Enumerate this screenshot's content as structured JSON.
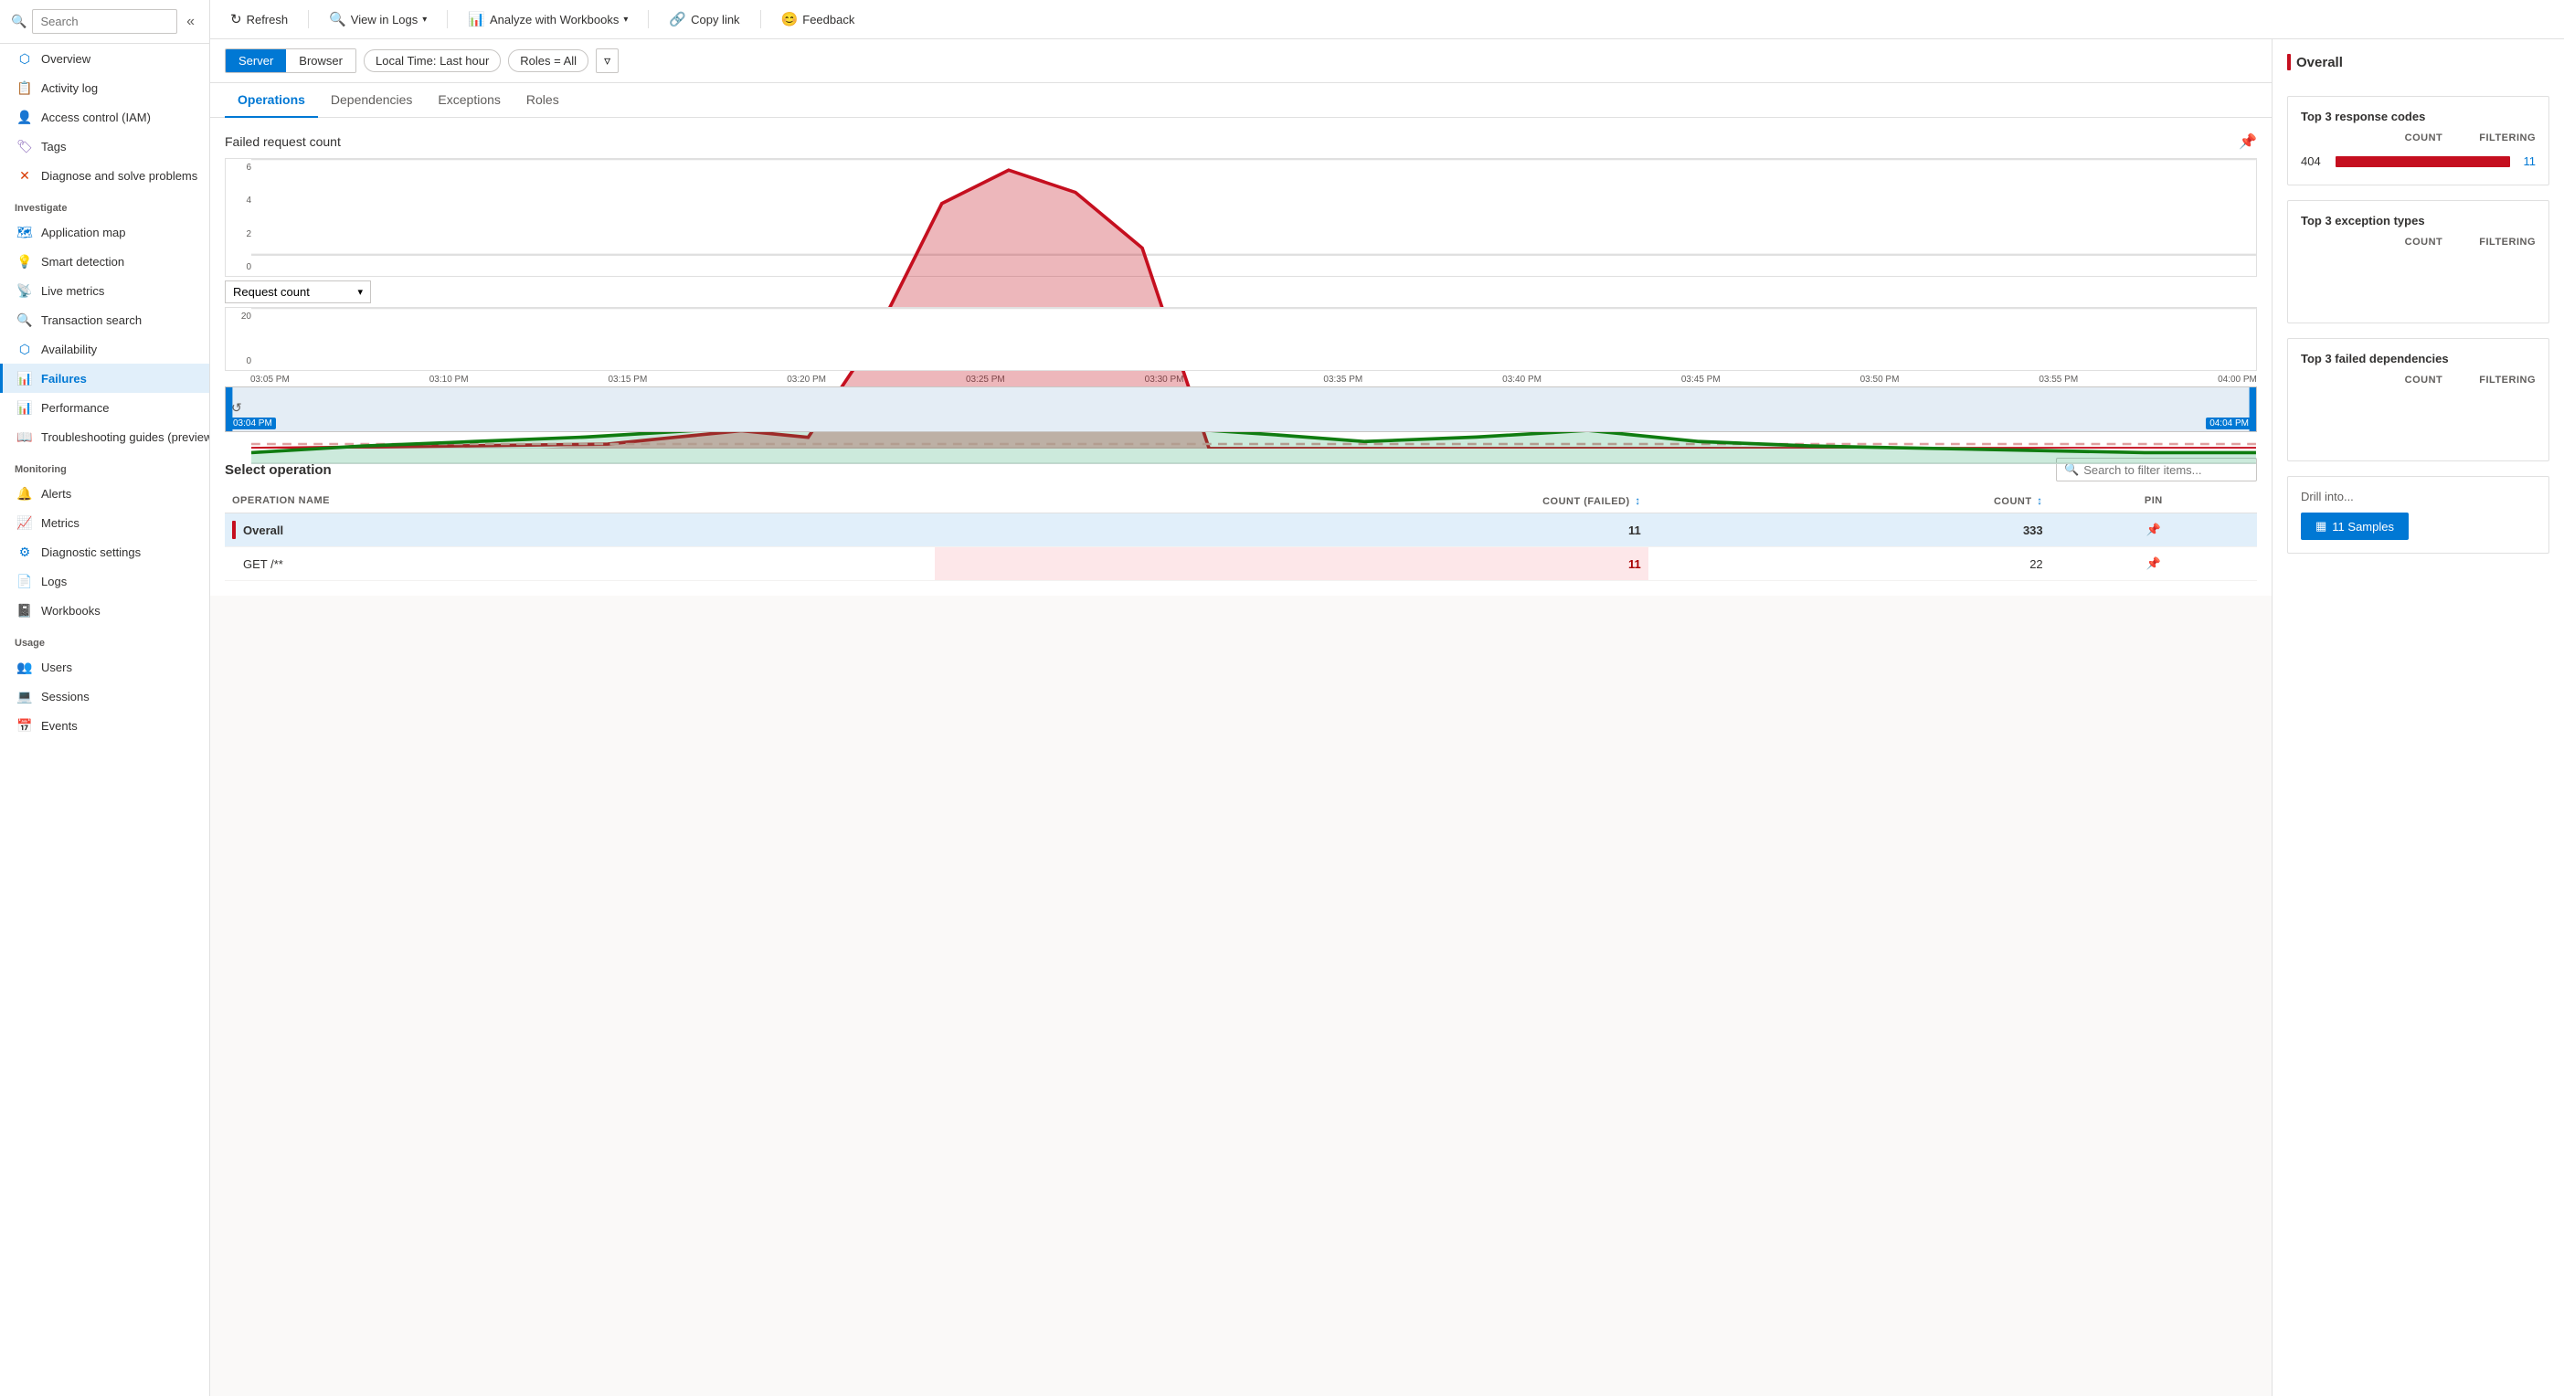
{
  "sidebar": {
    "search_placeholder": "Search",
    "collapse_label": "Collapse",
    "items": [
      {
        "id": "overview",
        "label": "Overview",
        "icon": "⬡",
        "icon_class": "icon-overview"
      },
      {
        "id": "activity-log",
        "label": "Activity log",
        "icon": "📋",
        "icon_class": "icon-activity"
      },
      {
        "id": "access-control",
        "label": "Access control (IAM)",
        "icon": "👤",
        "icon_class": "icon-iam"
      },
      {
        "id": "tags",
        "label": "Tags",
        "icon": "🏷",
        "icon_class": "icon-tags"
      },
      {
        "id": "diagnose",
        "label": "Diagnose and solve problems",
        "icon": "✕",
        "icon_class": "icon-diagnose"
      }
    ],
    "investigate_label": "Investigate",
    "investigate_items": [
      {
        "id": "app-map",
        "label": "Application map",
        "icon": "🗺",
        "icon_class": "icon-appmap"
      },
      {
        "id": "smart-detect",
        "label": "Smart detection",
        "icon": "💡",
        "icon_class": "icon-smart"
      },
      {
        "id": "live-metrics",
        "label": "Live metrics",
        "icon": "🔍",
        "icon_class": "icon-live"
      },
      {
        "id": "tx-search",
        "label": "Transaction search",
        "icon": "🔍",
        "icon_class": "icon-txsearch"
      },
      {
        "id": "availability",
        "label": "Availability",
        "icon": "⬡",
        "icon_class": "icon-availability"
      },
      {
        "id": "failures",
        "label": "Failures",
        "icon": "📊",
        "icon_class": "icon-failures",
        "active": true
      },
      {
        "id": "performance",
        "label": "Performance",
        "icon": "📊",
        "icon_class": "icon-perf"
      },
      {
        "id": "troubleshoot",
        "label": "Troubleshooting guides (preview)",
        "icon": "📖",
        "icon_class": "icon-troubleshoot"
      }
    ],
    "monitoring_label": "Monitoring",
    "monitoring_items": [
      {
        "id": "alerts",
        "label": "Alerts",
        "icon": "🔔",
        "icon_class": "icon-alerts"
      },
      {
        "id": "metrics",
        "label": "Metrics",
        "icon": "📈",
        "icon_class": "icon-metrics"
      },
      {
        "id": "diagnostic-settings",
        "label": "Diagnostic settings",
        "icon": "⚙",
        "icon_class": "icon-diag"
      },
      {
        "id": "logs",
        "label": "Logs",
        "icon": "📄",
        "icon_class": "icon-logs"
      },
      {
        "id": "workbooks",
        "label": "Workbooks",
        "icon": "📓",
        "icon_class": "icon-workbooks"
      }
    ],
    "usage_label": "Usage",
    "usage_items": [
      {
        "id": "users",
        "label": "Users",
        "icon": "👥",
        "icon_class": "icon-users"
      },
      {
        "id": "sessions",
        "label": "Sessions",
        "icon": "💻",
        "icon_class": "icon-sessions"
      },
      {
        "id": "events",
        "label": "Events",
        "icon": "📅",
        "icon_class": "icon-events"
      }
    ]
  },
  "toolbar": {
    "refresh_label": "Refresh",
    "view_logs_label": "View in Logs",
    "analyze_label": "Analyze with Workbooks",
    "copy_link_label": "Copy link",
    "feedback_label": "Feedback"
  },
  "filter_bar": {
    "server_label": "Server",
    "browser_label": "Browser",
    "time_label": "Local Time: Last hour",
    "roles_label": "Roles = All"
  },
  "tabs": [
    {
      "id": "operations",
      "label": "Operations",
      "active": true
    },
    {
      "id": "dependencies",
      "label": "Dependencies"
    },
    {
      "id": "exceptions",
      "label": "Exceptions"
    },
    {
      "id": "roles",
      "label": "Roles"
    }
  ],
  "chart": {
    "title": "Failed request count",
    "y_labels": [
      "6",
      "4",
      "2",
      "0"
    ],
    "time_labels": [
      "03:05 PM",
      "03:10 PM",
      "03:15 PM",
      "03:20 PM",
      "03:25 PM",
      "03:30 PM",
      "03:35 PM",
      "03:40 PM",
      "03:45 PM",
      "03:50 PM",
      "03:55 PM",
      "04:00 PM"
    ],
    "dropdown_label": "Request count",
    "bottom_y_labels": [
      "20",
      "0"
    ],
    "brush_start": "03:04 PM",
    "brush_end": "04:04 PM"
  },
  "operations_table": {
    "title": "Select operation",
    "search_placeholder": "Search to filter items...",
    "columns": {
      "name": "OPERATION NAME",
      "count_failed": "COUNT (FAILED)",
      "count": "COUNT",
      "pin": "PIN"
    },
    "rows": [
      {
        "id": "overall",
        "name": "Overall",
        "count_failed": "11",
        "count": "333",
        "selected": true,
        "color": "#c50f1f"
      },
      {
        "id": "get-star",
        "name": "GET /**",
        "count_failed": "11",
        "count": "22",
        "selected": false,
        "color": null
      }
    ]
  },
  "right_panel": {
    "overall_title": "Overall",
    "top_response_codes": {
      "title": "Top 3 response codes",
      "count_header": "COUNT",
      "filtering_header": "FILTERING",
      "rows": [
        {
          "code": "404",
          "count": "11",
          "bar_width": "70%"
        }
      ]
    },
    "top_exception_types": {
      "title": "Top 3 exception types",
      "count_header": "COUNT",
      "filtering_header": "FILTERING"
    },
    "top_failed_deps": {
      "title": "Top 3 failed dependencies",
      "count_header": "COUNT",
      "filtering_header": "FILTERING"
    },
    "drill_title": "Drill into...",
    "drill_btn_label": "11 Samples"
  }
}
